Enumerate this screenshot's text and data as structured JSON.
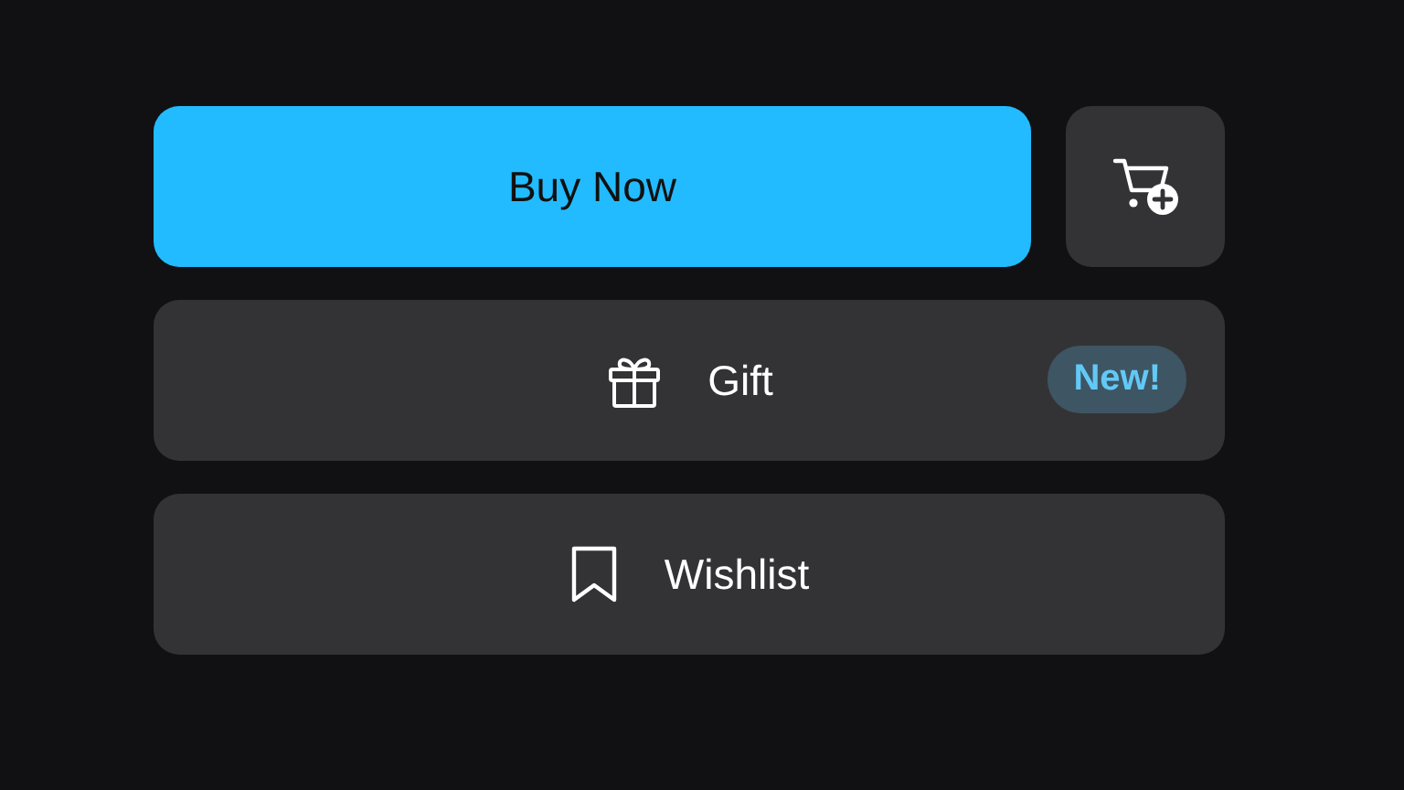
{
  "actions": [
    {
      "kind": "primary",
      "label": "Buy Now"
    },
    {
      "kind": "add_to_cart"
    }
  ],
  "options": [
    {
      "kind": "gift",
      "label": "Gift",
      "badge": "New!"
    },
    {
      "kind": "wishlist",
      "label": "Wishlist"
    }
  ]
}
